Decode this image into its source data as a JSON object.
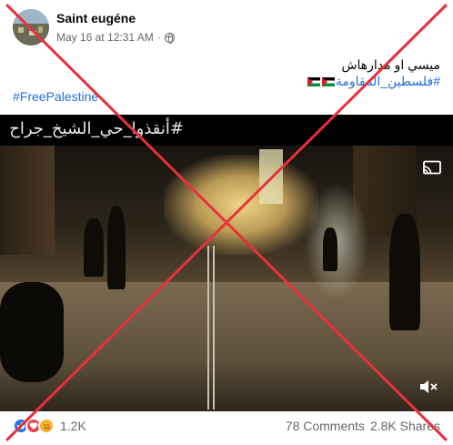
{
  "post": {
    "author": "Saint eugéne",
    "timestamp": "May 16 at 12:31 AM",
    "separator": "·",
    "audience_icon": "globe-icon",
    "text_line1": "ميسي او مدارهاش",
    "text_line2_hashtag": "#فلسطين_المقاومة",
    "hashtag_en": "#FreePalestine"
  },
  "video": {
    "overlay_caption": "#أنقذوا_حي_الشيخ_جراح",
    "cast_icon": "cast-icon",
    "mute_icon": "mute-icon"
  },
  "stats": {
    "reaction_icons": [
      "like-icon",
      "love-icon",
      "care-icon"
    ],
    "reaction_count": "1.2K",
    "comments": "78 Comments",
    "shares": "2.8K Shares"
  },
  "overlay": {
    "x_color": "#e8313a"
  }
}
